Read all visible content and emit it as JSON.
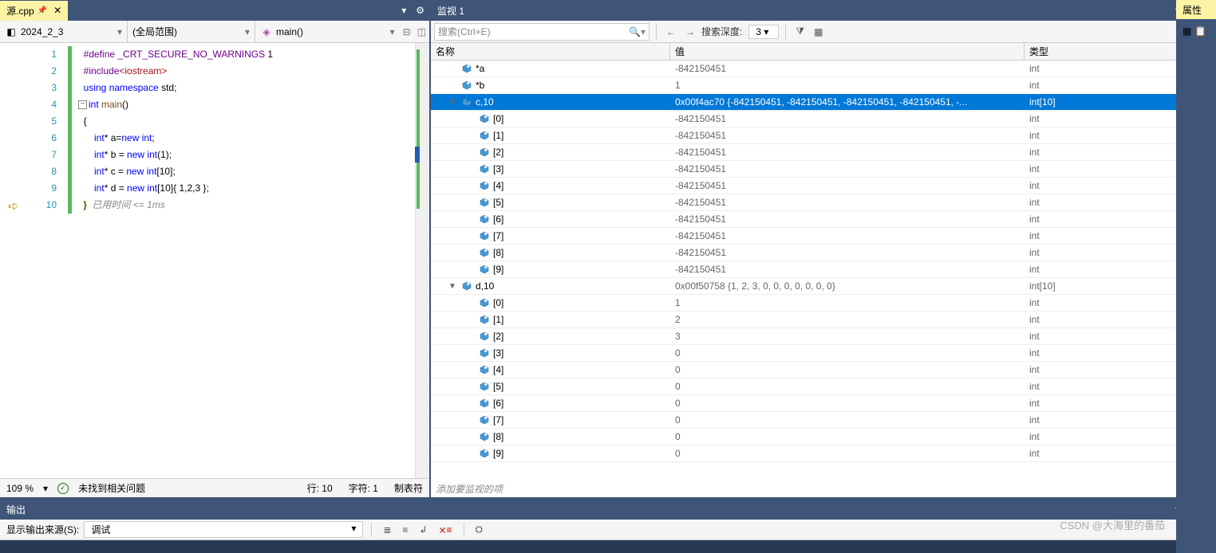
{
  "editor": {
    "tabName": "源.cpp",
    "navProject": "2024_2_3",
    "navScope": "(全局范围)",
    "navFunction": "main()",
    "zoom": "109 %",
    "noIssues": "未找到相关问题",
    "statusLine": "行: 10",
    "statusChar": "字符: 1",
    "statusTab": "制表符",
    "lines": [
      "1",
      "2",
      "3",
      "4",
      "5",
      "6",
      "7",
      "8",
      "9",
      "10"
    ],
    "timing": "已用时间 <= 1ms",
    "code": {
      "l1a": "#define ",
      "l1b": "_CRT_SECURE_NO_WARNINGS",
      "l1c": " 1",
      "l2a": "#include",
      "l2b": "<iostream>",
      "l3a": "using ",
      "l3b": "namespace",
      "l3c": " std;",
      "l4a": "int ",
      "l4b": "main",
      "l4c": "()",
      "l5": "{",
      "l6a": "    int",
      "l6b": "* a=",
      "l6c": "new ",
      "l6d": "int",
      "l6e": ";",
      "l7a": "    int",
      "l7b": "* b = ",
      "l7c": "new ",
      "l7d": "int",
      "l7e": "(1);",
      "l8a": "    int",
      "l8b": "* c = ",
      "l8c": "new ",
      "l8d": "int",
      "l8e": "[10];",
      "l9a": "    int",
      "l9b": "* d = ",
      "l9c": "new ",
      "l9d": "int",
      "l9e": "[10]{ 1,2,3 };",
      "l10": "}"
    }
  },
  "watch": {
    "title": "监视 1",
    "searchPlaceholder": "搜索(Ctrl+E)",
    "depthLabel": "搜索深度:",
    "depthValue": "3",
    "colName": "名称",
    "colValue": "值",
    "colType": "类型",
    "addWatch": "添加要监视的项",
    "rows": [
      {
        "indent": 1,
        "expand": "",
        "name": "*a",
        "value": "-842150451",
        "type": "int",
        "sel": false
      },
      {
        "indent": 1,
        "expand": "",
        "name": "*b",
        "value": "1",
        "type": "int",
        "sel": false
      },
      {
        "indent": 1,
        "expand": "▼",
        "name": "c,10",
        "value": "0x00f4ac70 {-842150451, -842150451, -842150451, -842150451, -...",
        "type": "int[10]",
        "sel": true
      },
      {
        "indent": 2,
        "expand": "",
        "name": "[0]",
        "value": "-842150451",
        "type": "int",
        "sel": false
      },
      {
        "indent": 2,
        "expand": "",
        "name": "[1]",
        "value": "-842150451",
        "type": "int",
        "sel": false
      },
      {
        "indent": 2,
        "expand": "",
        "name": "[2]",
        "value": "-842150451",
        "type": "int",
        "sel": false
      },
      {
        "indent": 2,
        "expand": "",
        "name": "[3]",
        "value": "-842150451",
        "type": "int",
        "sel": false
      },
      {
        "indent": 2,
        "expand": "",
        "name": "[4]",
        "value": "-842150451",
        "type": "int",
        "sel": false
      },
      {
        "indent": 2,
        "expand": "",
        "name": "[5]",
        "value": "-842150451",
        "type": "int",
        "sel": false
      },
      {
        "indent": 2,
        "expand": "",
        "name": "[6]",
        "value": "-842150451",
        "type": "int",
        "sel": false
      },
      {
        "indent": 2,
        "expand": "",
        "name": "[7]",
        "value": "-842150451",
        "type": "int",
        "sel": false
      },
      {
        "indent": 2,
        "expand": "",
        "name": "[8]",
        "value": "-842150451",
        "type": "int",
        "sel": false
      },
      {
        "indent": 2,
        "expand": "",
        "name": "[9]",
        "value": "-842150451",
        "type": "int",
        "sel": false
      },
      {
        "indent": 1,
        "expand": "▼",
        "name": "d,10",
        "value": "0x00f50758 {1, 2, 3, 0, 0, 0, 0, 0, 0, 0}",
        "type": "int[10]",
        "sel": false
      },
      {
        "indent": 2,
        "expand": "",
        "name": "[0]",
        "value": "1",
        "type": "int",
        "sel": false
      },
      {
        "indent": 2,
        "expand": "",
        "name": "[1]",
        "value": "2",
        "type": "int",
        "sel": false
      },
      {
        "indent": 2,
        "expand": "",
        "name": "[2]",
        "value": "3",
        "type": "int",
        "sel": false
      },
      {
        "indent": 2,
        "expand": "",
        "name": "[3]",
        "value": "0",
        "type": "int",
        "sel": false
      },
      {
        "indent": 2,
        "expand": "",
        "name": "[4]",
        "value": "0",
        "type": "int",
        "sel": false
      },
      {
        "indent": 2,
        "expand": "",
        "name": "[5]",
        "value": "0",
        "type": "int",
        "sel": false
      },
      {
        "indent": 2,
        "expand": "",
        "name": "[6]",
        "value": "0",
        "type": "int",
        "sel": false
      },
      {
        "indent": 2,
        "expand": "",
        "name": "[7]",
        "value": "0",
        "type": "int",
        "sel": false
      },
      {
        "indent": 2,
        "expand": "",
        "name": "[8]",
        "value": "0",
        "type": "int",
        "sel": false
      },
      {
        "indent": 2,
        "expand": "",
        "name": "[9]",
        "value": "0",
        "type": "int",
        "sel": false
      }
    ]
  },
  "output": {
    "title": "输出",
    "sourceLabel": "显示输出来源(S):",
    "sourceValue": "调试"
  },
  "rightPanel": {
    "tab": "属性"
  },
  "watermark": "CSDN @大海里的番茄"
}
